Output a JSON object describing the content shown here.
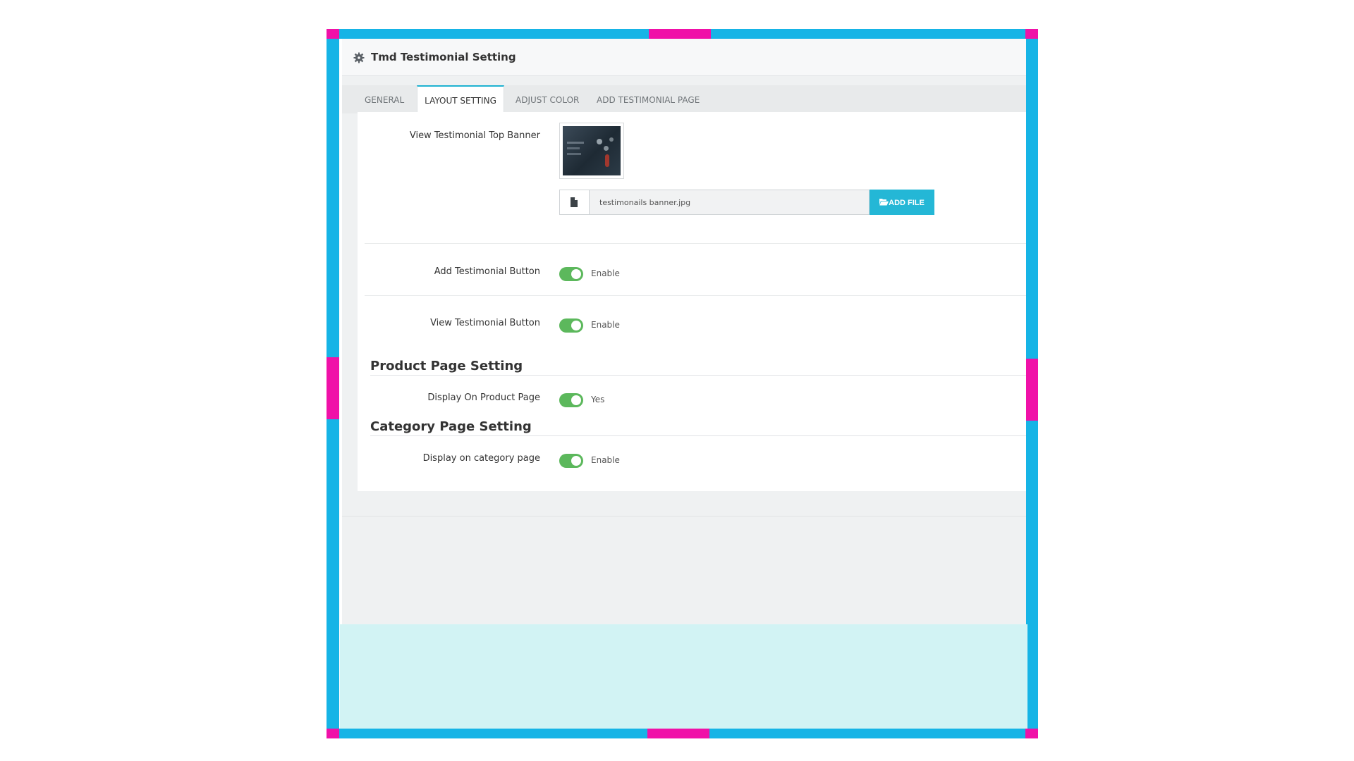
{
  "colors": {
    "frame_blue": "#16b4e6",
    "frame_magenta": "#f011a8",
    "toggle_on": "#5cb85c",
    "accent_button": "#24b7d6",
    "active_tab_border": "#1fb2d1",
    "cyan_area": "#d2f3f4"
  },
  "panel": {
    "title": "Tmd Testimonial Setting",
    "icon": "gear-icon"
  },
  "tabs": [
    {
      "label": "GENERAL",
      "active": false
    },
    {
      "label": "LAYOUT SETTING",
      "active": true
    },
    {
      "label": "ADJUST COLOR",
      "active": false
    },
    {
      "label": "ADD TESTIMONIAL PAGE",
      "active": false
    }
  ],
  "layout_setting": {
    "banner": {
      "label": "View Testimonial Top Banner",
      "file_name": "testimonails banner.jpg",
      "file_icon": "file-icon",
      "button_icon": "folder-open-icon",
      "button_label": "ADD FILE"
    },
    "add_testimonial_button": {
      "label": "Add Testimonial Button",
      "state_label": "Enable",
      "enabled": true
    },
    "view_testimonial_button": {
      "label": "View Testimonial Button",
      "state_label": "Enable",
      "enabled": true
    }
  },
  "product_page": {
    "title": "Product Page Setting",
    "display": {
      "label": "Display On Product Page",
      "state_label": "Yes",
      "enabled": true
    }
  },
  "category_page": {
    "title": "Category Page Setting",
    "display": {
      "label": "Display on category page",
      "state_label": "Enable",
      "enabled": true
    }
  }
}
